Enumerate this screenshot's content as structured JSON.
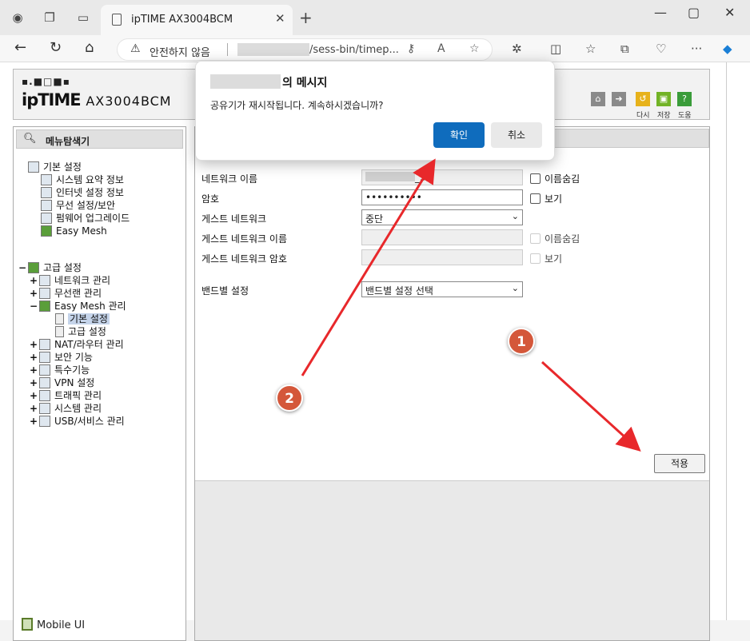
{
  "browser": {
    "tab_title": "ipTIME AX3004BCM",
    "address_security": "안전하지 않음",
    "address_path": "/sess-bin/timep..."
  },
  "router": {
    "logo_text": "ipTIME",
    "model": "AX3004BCM",
    "header_buttons": [
      "다시",
      "저장",
      "도움"
    ]
  },
  "sidebar": {
    "title": "메뉴탐색기",
    "basic_group": "기본 설정",
    "basic_items": [
      "시스템 요약 정보",
      "인터넷 설정 정보",
      "무선 설정/보안",
      "펌웨어 업그레이드",
      "Easy Mesh"
    ],
    "advanced_group": "고급 설정",
    "advanced_items": [
      "네트워크 관리",
      "무선랜 관리",
      "Easy Mesh 관리",
      "NAT/라우터 관리",
      "보안 기능",
      "특수기능",
      "VPN 설정",
      "트래픽 관리",
      "시스템 관리",
      "USB/서비스 관리"
    ],
    "mesh_sub_items": [
      "기본 설정",
      "고급 설정"
    ],
    "mobile_ui": "Mobile UI"
  },
  "form": {
    "network_name_label": "네트워크 이름",
    "network_name_value": "_5G",
    "hide_name_label": "이름숨김",
    "password_label": "암호",
    "password_value": "••••••••••",
    "show_label": "보기",
    "guest_network_label": "게스트 네트워크",
    "guest_network_value": "중단",
    "guest_name_label": "게스트 네트워크 이름",
    "guest_hide_label": "이름숨김",
    "guest_password_label": "게스트 네트워크 암호",
    "guest_show_label": "보기",
    "band_label": "밴드별 설정",
    "band_value": "밴드별 설정 선택",
    "apply_label": "적용"
  },
  "dialog": {
    "title_suffix": "의 메시지",
    "message": "공유기가 재시작됩니다. 계속하시겠습니까?",
    "ok_label": "확인",
    "cancel_label": "취소"
  },
  "annotations": {
    "badge1": "1",
    "badge2": "2",
    "arrow_color": "#e8282b",
    "badge_color": "#d4573a"
  },
  "colors": {
    "ok_button": "#0f6cbd",
    "selected_item": "#c5d4ea"
  }
}
